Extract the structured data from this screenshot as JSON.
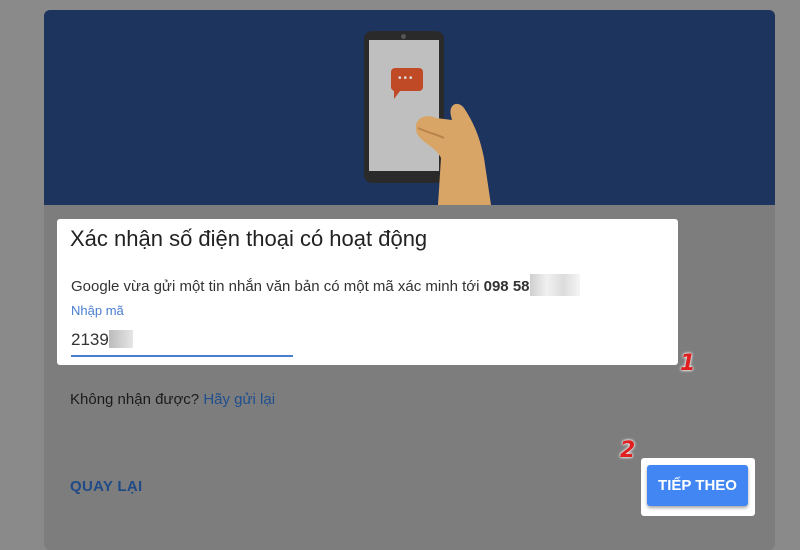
{
  "dialog": {
    "title": "Xác nhận số điện thoại có hoạt động",
    "message_prefix": "Google vừa gửi một tin nhắn văn bản có một mã xác minh tới ",
    "phone_visible": "098 58",
    "code_label": "Nhập mã",
    "code_value_visible": "2139"
  },
  "resend": {
    "prompt": "Không nhận được? ",
    "link": "Hãy gửi lại"
  },
  "actions": {
    "back_label": "QUAY LẠI",
    "next_label": "TIẾP THEO"
  },
  "annotations": {
    "marker_1": "1",
    "marker_2": "2",
    "marker_color": "#e02020"
  },
  "colors": {
    "hero_background": "#1d345e",
    "accent_blue": "#4286f4",
    "link_blue": "#1f4f8f"
  },
  "icons": {
    "hero": "phone-sms-illustration"
  }
}
